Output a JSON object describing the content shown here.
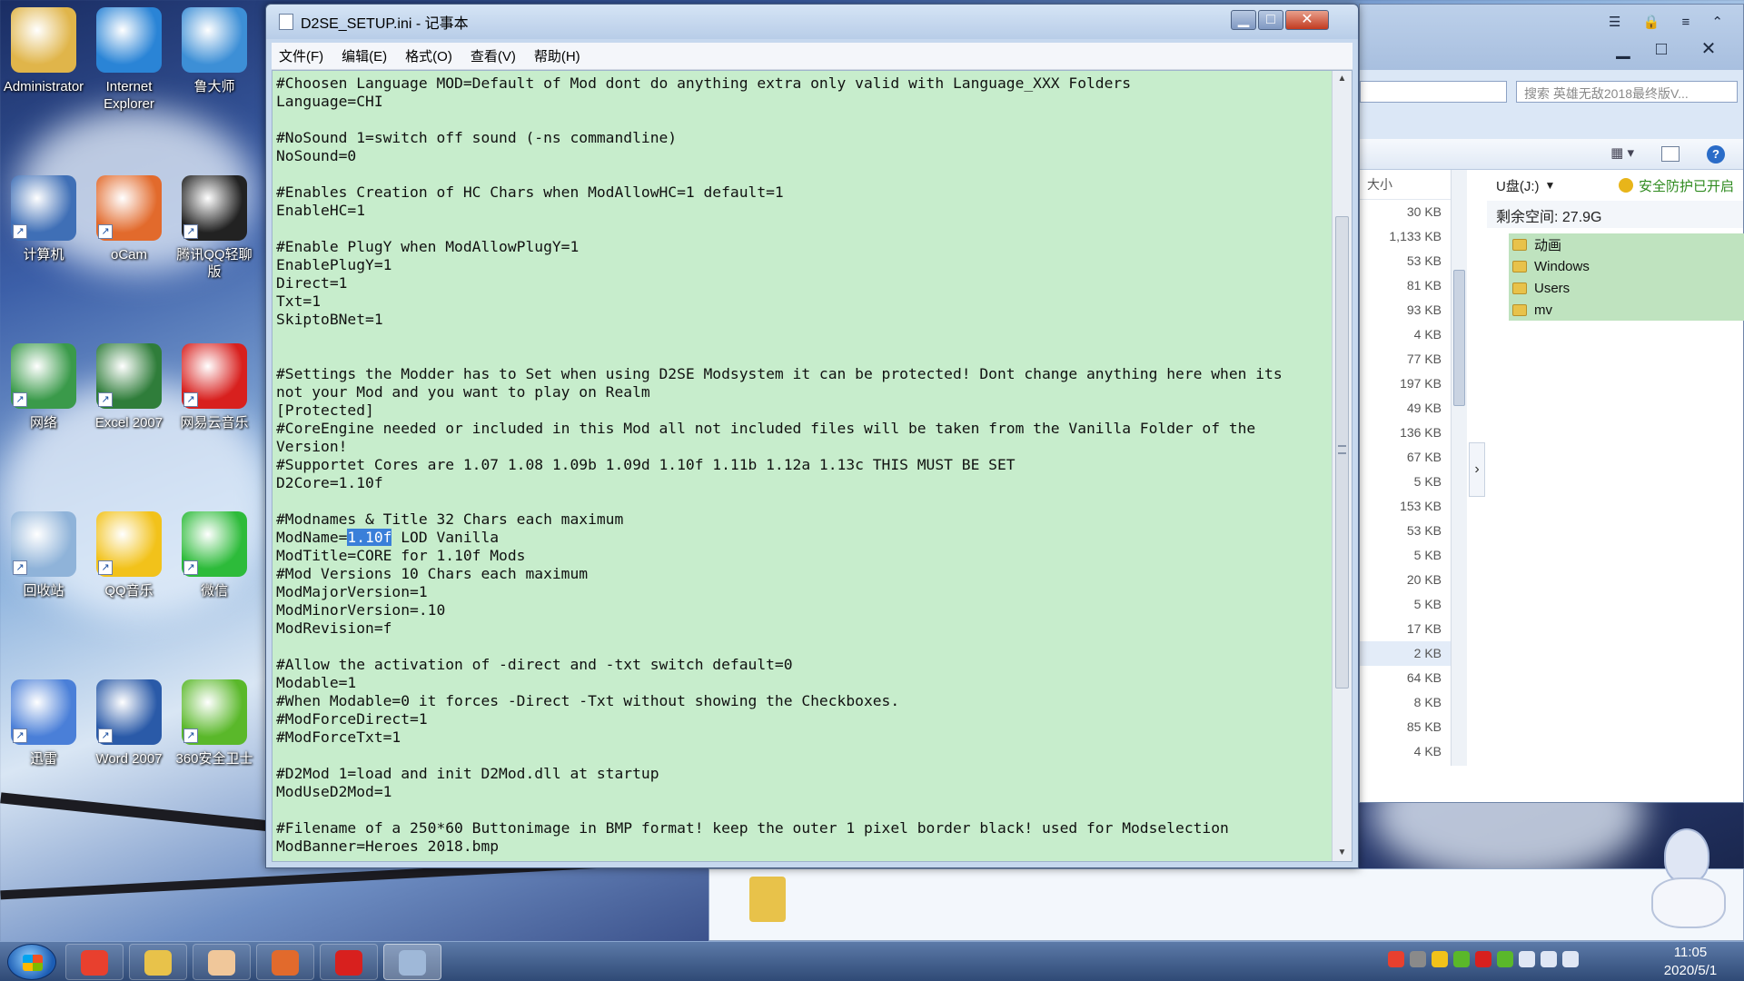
{
  "desktop": {
    "icons": [
      {
        "label": "Administrator",
        "icon": "user-folder-icon",
        "color": "#e0b54a"
      },
      {
        "label": "Internet Explorer",
        "icon": "internet-explorer-icon",
        "color": "#2a84d6"
      },
      {
        "label": "鲁大师",
        "icon": "ludashi-icon",
        "color": "#3d8fd6"
      },
      {
        "label": "计算机",
        "icon": "computer-icon",
        "color": "#3f6fb6"
      },
      {
        "label": "oCam",
        "icon": "ocam-icon",
        "color": "#e26a2c"
      },
      {
        "label": "腾讯QQ轻聊版",
        "icon": "qq-penguin-icon",
        "color": "#222222"
      },
      {
        "label": "网络",
        "icon": "network-icon",
        "color": "#3a9a4a"
      },
      {
        "label": "Excel 2007",
        "icon": "excel-icon",
        "color": "#2f7d3a"
      },
      {
        "label": "网易云音乐",
        "icon": "netease-music-icon",
        "color": "#d8201e"
      },
      {
        "label": "回收站",
        "icon": "recycle-bin-icon",
        "color": "#8fb3d9"
      },
      {
        "label": "QQ音乐",
        "icon": "qq-music-icon",
        "color": "#f2c21a"
      },
      {
        "label": "微信",
        "icon": "wechat-icon",
        "color": "#2dbb3a"
      },
      {
        "label": "迅雷",
        "icon": "xunlei-bird-icon",
        "color": "#4a7fd8"
      },
      {
        "label": "Word 2007",
        "icon": "word-icon",
        "color": "#2a5aa8"
      },
      {
        "label": "360安全卫士",
        "icon": "360-security-icon",
        "color": "#5ab82a"
      }
    ]
  },
  "notepad": {
    "title": "D2SE_SETUP.ini - 记事本",
    "controls": {
      "minimize": "▁",
      "maximize": "□",
      "close": "✕"
    },
    "menu": [
      "文件(F)",
      "编辑(E)",
      "格式(O)",
      "查看(V)",
      "帮助(H)"
    ],
    "lines": [
      "#Choosen Language MOD=Default of Mod dont do anything extra only valid with Language_XXX Folders",
      "Language=CHI",
      "",
      "#NoSound 1=switch off sound (-ns commandline)",
      "NoSound=0",
      "",
      "#Enables Creation of HC Chars when ModAllowHC=1 default=1",
      "EnableHC=1",
      "",
      "#Enable PlugY when ModAllowPlugY=1",
      "EnablePlugY=1",
      "Direct=1",
      "Txt=1",
      "SkiptoBNet=1",
      "",
      "",
      "#Settings the Modder has to Set when using D2SE Modsystem it can be protected! Dont change anything here when its",
      "not your Mod and you want to play on Realm",
      "[Protected]",
      "#CoreEngine needed or included in this Mod all not included files will be taken from the Vanilla Folder of the",
      "Version!",
      "#Supportet Cores are 1.07 1.08 1.09b 1.09d 1.10f 1.11b 1.12a 1.13c THIS MUST BE SET",
      "D2Core=1.10f",
      "",
      "#Modnames & Title 32 Chars each maximum"
    ],
    "selected_line": {
      "before": "ModName=",
      "selected": "1.10f",
      "after": " LOD Vanilla"
    },
    "lines_after": [
      "ModTitle=CORE for 1.10f Mods",
      "#Mod Versions 10 Chars each maximum",
      "ModMajorVersion=1",
      "ModMinorVersion=.10",
      "ModRevision=f",
      "",
      "#Allow the activation of -direct and -txt switch default=0",
      "Modable=1",
      "#When Modable=0 it forces -Direct -Txt without showing the Checkboxes.",
      "#ModForceDirect=1",
      "#ModForceTxt=1",
      "",
      "#D2Mod 1=load and init D2Mod.dll at startup",
      "ModUseD2Mod=1",
      "",
      "#Filename of a 250*60 Buttonimage in BMP format! keep the outer 1 pixel border black! used for Modselection",
      "ModBanner=Heroes 2018.bmp"
    ],
    "editor_bg": "#c7edcc",
    "selection_color": "#3a7fd9"
  },
  "explorer": {
    "search_placeholder": "搜索 英雄无敌2018最终版V...",
    "size_header": "大小",
    "sizes": [
      "30 KB",
      "1,133 KB",
      "53 KB",
      "81 KB",
      "93 KB",
      "4 KB",
      "77 KB",
      "197 KB",
      "49 KB",
      "136 KB",
      "67 KB",
      "5 KB",
      "153 KB",
      "53 KB",
      "5 KB",
      "20 KB",
      "5 KB",
      "17 KB",
      "2 KB",
      "64 KB",
      "8 KB",
      "85 KB",
      "4 KB"
    ],
    "selected_size_index": 18,
    "drive_label": "U盘(J:)",
    "protection_status": "安全防护已开启",
    "free_space": "剩余空间: 27.9G",
    "folders": [
      "动画",
      "Windows",
      "Users",
      "mv"
    ],
    "accent_green": "#2e8a1e"
  },
  "taskbar": {
    "apps": [
      "chrome-icon",
      "file-explorer-icon",
      "anime-avatar-icon",
      "ocam-icon",
      "netease-music-icon",
      "notepad-icon"
    ],
    "active_app": "notepad-icon",
    "tray": [
      "sogou-input-icon",
      "usb-icon",
      "qq-icon",
      "nvidia-icon",
      "netease-music-icon",
      "360-icon",
      "volume-icon",
      "network-icon",
      "display-icon"
    ],
    "time": "11:05",
    "date": "2020/5/1"
  }
}
